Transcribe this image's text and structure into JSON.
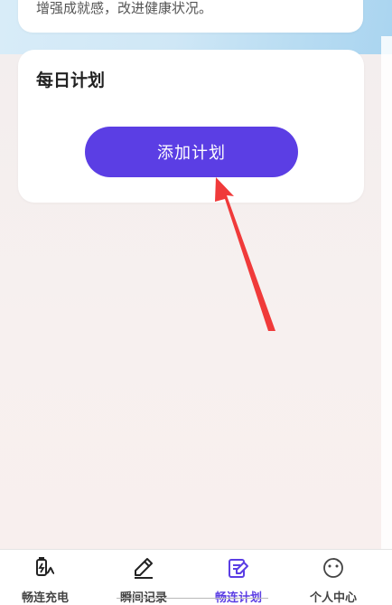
{
  "intro": {
    "text": "增强成就感，改进健康状况。"
  },
  "plan_card": {
    "title": "每日计划",
    "add_button_label": "添加计划"
  },
  "tabbar": {
    "tabs": [
      {
        "label": "畅连充电",
        "icon": "charger-icon",
        "active": false
      },
      {
        "label": "瞬间记录",
        "icon": "pencil-icon",
        "active": false
      },
      {
        "label": "畅连计划",
        "icon": "edit-note-icon",
        "active": true
      },
      {
        "label": "个人中心",
        "icon": "smiley-face-icon",
        "active": false
      }
    ]
  },
  "colors": {
    "accent": "#5b3ee4",
    "annotation_arrow": "#f03a3a"
  }
}
